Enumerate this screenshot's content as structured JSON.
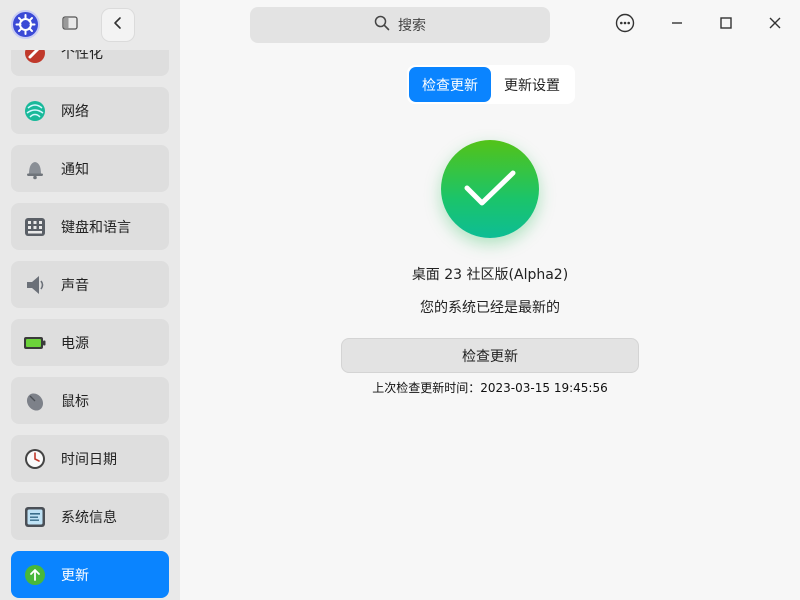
{
  "header": {
    "search_placeholder": "搜索"
  },
  "sidebar": {
    "items": [
      {
        "label": "个性化",
        "icon": "personalization-icon"
      },
      {
        "label": "网络",
        "icon": "network-icon"
      },
      {
        "label": "通知",
        "icon": "bell-icon"
      },
      {
        "label": "键盘和语言",
        "icon": "keyboard-icon"
      },
      {
        "label": "声音",
        "icon": "speaker-icon"
      },
      {
        "label": "电源",
        "icon": "battery-icon"
      },
      {
        "label": "鼠标",
        "icon": "mouse-icon"
      },
      {
        "label": "时间日期",
        "icon": "clock-icon"
      },
      {
        "label": "系统信息",
        "icon": "info-icon"
      },
      {
        "label": "更新",
        "icon": "update-arrow-icon",
        "active": true
      }
    ]
  },
  "main": {
    "tabs": [
      {
        "label": "检查更新",
        "active": true
      },
      {
        "label": "更新设置",
        "active": false
      }
    ],
    "version": "桌面 23 社区版(Alpha2)",
    "status": "您的系统已经是最新的",
    "check_button": "检查更新",
    "last_check": "上次检查更新时间：2023-03-15 19:45:56"
  },
  "colors": {
    "accent": "#0a84ff",
    "success_top": "#53c318",
    "success_bottom": "#0dbd95"
  }
}
